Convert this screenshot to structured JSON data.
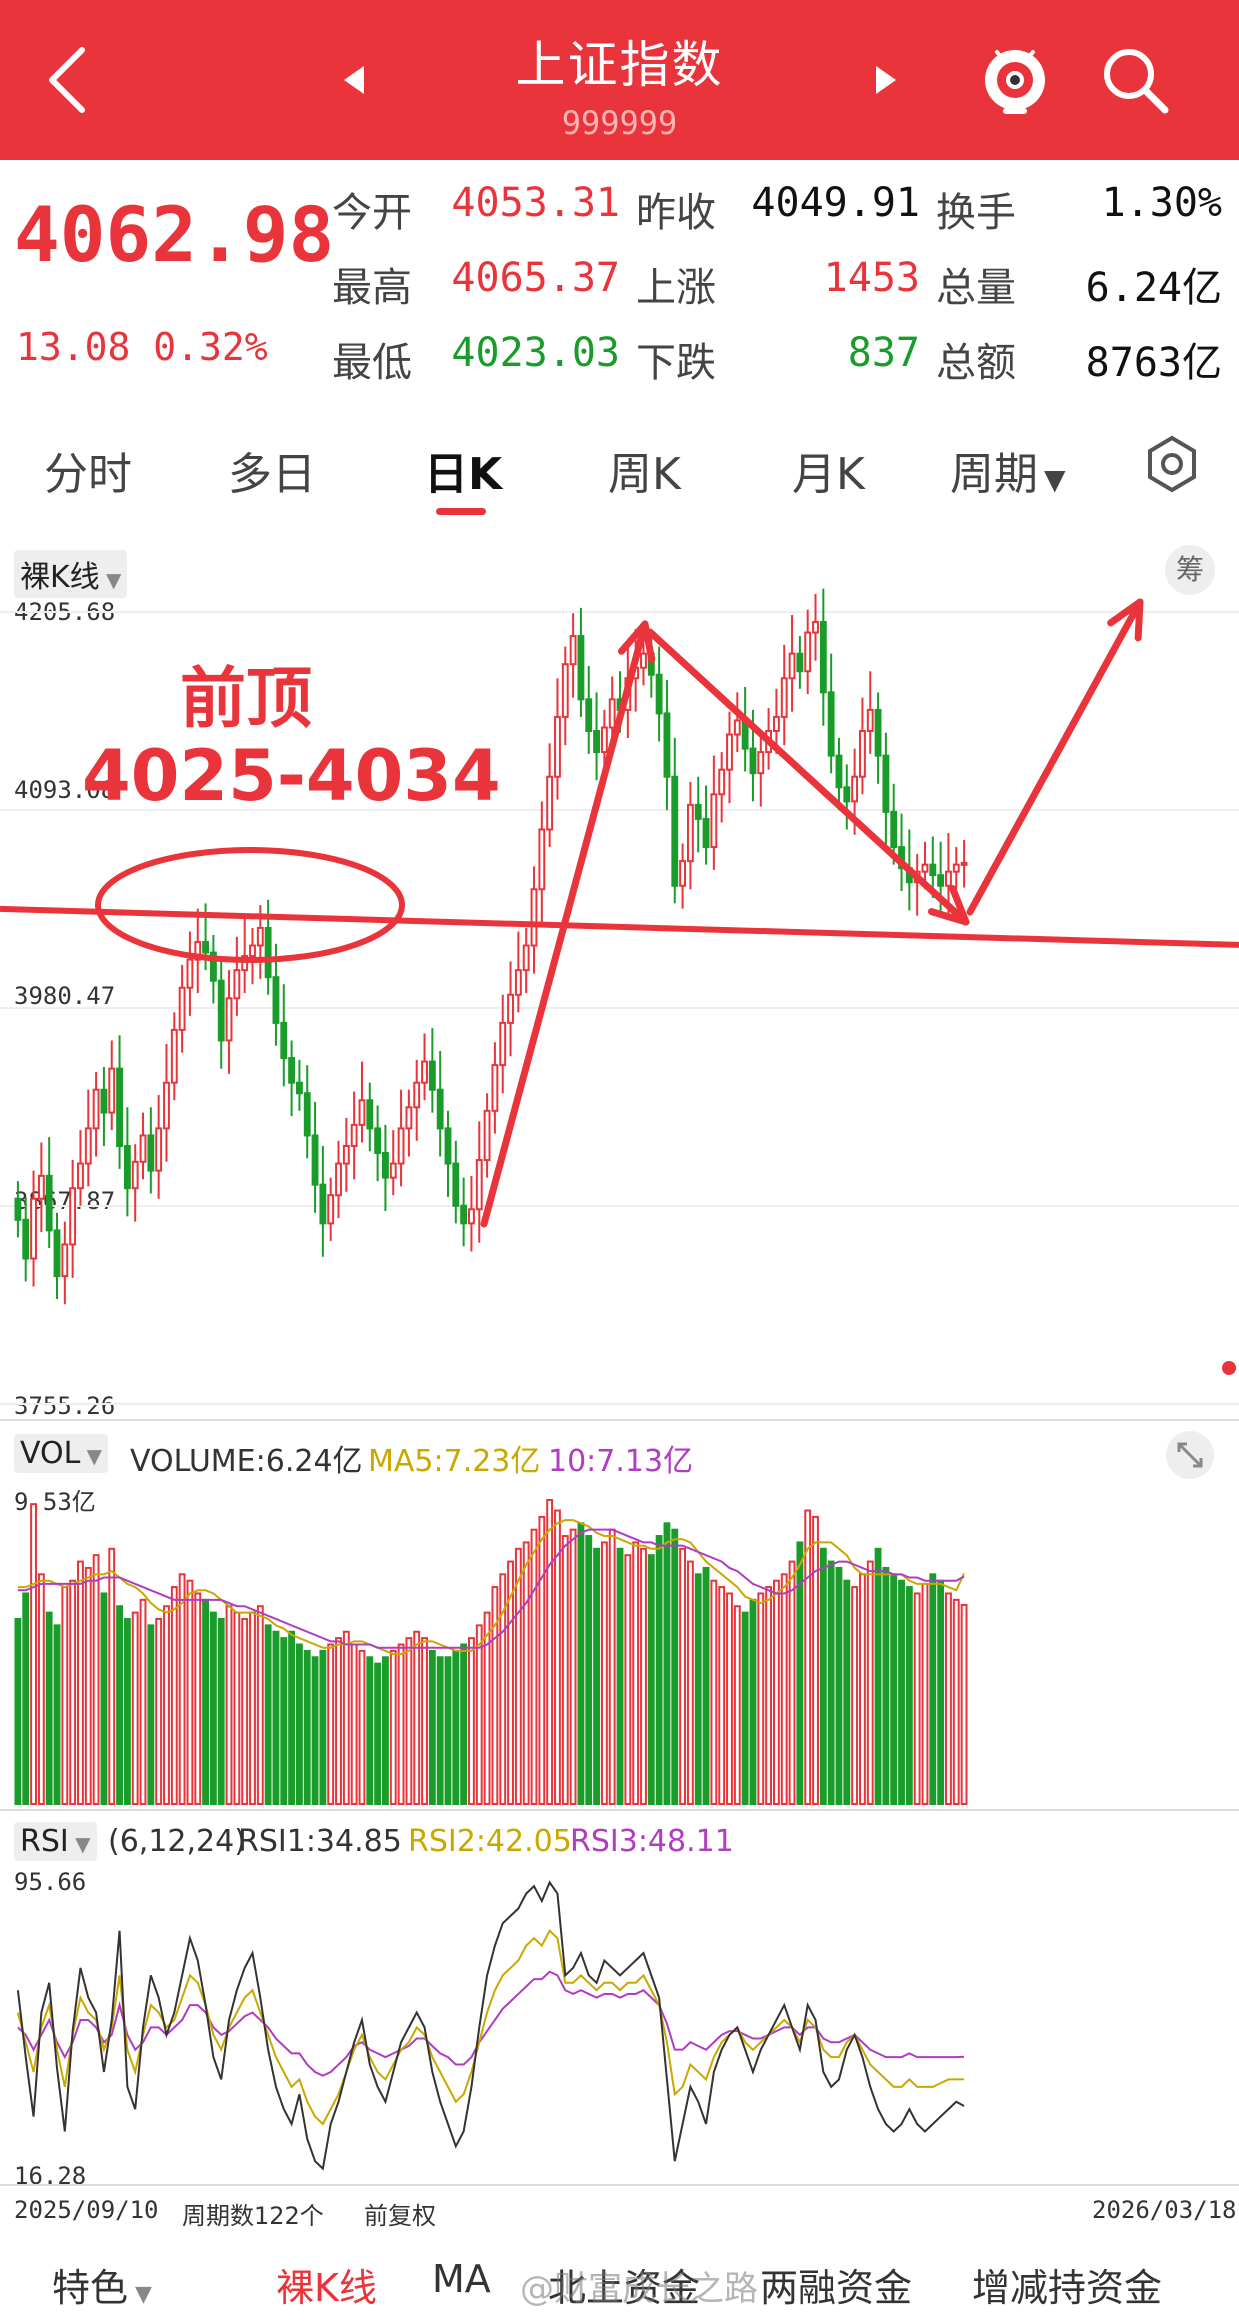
{
  "header": {
    "title": "上证指数",
    "code": "999999",
    "bg_color": "#e8343a"
  },
  "quote": {
    "price": "4062.98",
    "change": "13.08",
    "change_pct": "0.32%",
    "fields": [
      {
        "label": "今开",
        "value": "4053.31",
        "color": "red"
      },
      {
        "label": "昨收",
        "value": "4049.91",
        "color": "black"
      },
      {
        "label": "换手",
        "value": "1.30%",
        "color": "black"
      },
      {
        "label": "最高",
        "value": "4065.37",
        "color": "red"
      },
      {
        "label": "上涨",
        "value": "1453",
        "color": "red"
      },
      {
        "label": "总量",
        "value": "6.24亿",
        "color": "black"
      },
      {
        "label": "最低",
        "value": "4023.03",
        "color": "green"
      },
      {
        "label": "下跌",
        "value": "837",
        "color": "green"
      },
      {
        "label": "总额",
        "value": "8763亿",
        "color": "black"
      }
    ]
  },
  "tabs": [
    {
      "label": "分时"
    },
    {
      "label": "多日"
    },
    {
      "label": "日K",
      "active": true
    },
    {
      "label": "周K"
    },
    {
      "label": "月K"
    },
    {
      "label": "周期"
    }
  ],
  "kline": {
    "mode": "裸K线",
    "chip_btn": "筹",
    "y_labels": [
      "4205.68",
      "4093.08",
      "3980.47",
      "3867.87",
      "3755.26"
    ],
    "y_range": [
      3755.26,
      4205.68
    ],
    "annotation_title": "前顶",
    "annotation_range": "4025-4034",
    "resistance_level": 4030
  },
  "volume": {
    "tag": "VOL",
    "legend": {
      "volume": "VOLUME:6.24亿",
      "ma5": "MA5:7.23亿",
      "ma10": "10:7.13亿"
    },
    "max_label": "9.53亿"
  },
  "rsi": {
    "tag": "RSI",
    "legend": {
      "params": "(6,12,24)",
      "rsi1": "RSI1:34.85",
      "rsi2": "RSI2:42.05",
      "rsi3": "RSI3:48.11"
    },
    "top_label": "95.66",
    "bottom_label": "16.28"
  },
  "footer": {
    "start_date": "2025/09/10",
    "period_count": "周期数122个",
    "adjust": "前复权",
    "end_date": "2026/03/18"
  },
  "bottom_nav": [
    "特色",
    "裸K线",
    "MA",
    "北上资金",
    "两融资金",
    "增减持资金"
  ],
  "watermark": "@财富成长之路",
  "colors": {
    "up": "#e8343a",
    "down": "#1a9c2a",
    "ma5": "#c9a800",
    "ma10": "#b03cc0",
    "rsi1": "#333333"
  },
  "chart_data": {
    "type": "candlestick",
    "x_range": [
      "2025/09/10",
      "2026/03/18"
    ],
    "periods": 122,
    "price": [
      3860,
      3838,
      3872,
      3885,
      3854,
      3828,
      3846,
      3878,
      3892,
      3912,
      3934,
      3921,
      3946,
      3902,
      3878,
      3893,
      3908,
      3888,
      3912,
      3938,
      3968,
      3992,
      4008,
      4018,
      4012,
      3996,
      3962,
      3986,
      4002,
      4010,
      4016,
      4026,
      3998,
      3972,
      3952,
      3938,
      3932,
      3908,
      3880,
      3858,
      3874,
      3892,
      3902,
      3914,
      3928,
      3912,
      3898,
      3884,
      3892,
      3912,
      3924,
      3938,
      3950,
      3934,
      3912,
      3892,
      3868,
      3858,
      3866,
      3894,
      3922,
      3948,
      3972,
      3988,
      4002,
      4016,
      4048,
      4082,
      4112,
      4146,
      4176,
      4192,
      4156,
      4138,
      4126,
      4140,
      4156,
      4150,
      4168,
      4174,
      4182,
      4170,
      4148,
      4112,
      4050,
      4064,
      4096,
      4088,
      4072,
      4102,
      4116,
      4136,
      4144,
      4128,
      4114,
      4126,
      4138,
      4146,
      4168,
      4182,
      4172,
      4194,
      4200,
      4160,
      4124,
      4106,
      4098,
      4112,
      4138,
      4150,
      4124,
      4092,
      4072,
      4060,
      4052,
      4058,
      4062,
      4056,
      4050,
      4058,
      4062,
      4063
    ],
    "volume": [
      5.8,
      6.6,
      9.4,
      7.2,
      6.0,
      5.6,
      6.8,
      7.0,
      7.6,
      7.4,
      7.8,
      6.6,
      8.0,
      6.2,
      5.8,
      6.0,
      6.4,
      5.6,
      5.8,
      6.2,
      6.8,
      7.2,
      7.0,
      6.6,
      6.4,
      6.0,
      5.8,
      6.2,
      6.0,
      5.8,
      6.0,
      6.2,
      5.6,
      5.4,
      5.2,
      5.4,
      5.0,
      4.8,
      4.6,
      4.8,
      5.0,
      5.2,
      5.4,
      5.0,
      4.8,
      4.6,
      4.4,
      4.6,
      4.8,
      5.0,
      5.2,
      5.4,
      5.2,
      4.8,
      4.6,
      4.6,
      4.8,
      5.0,
      5.2,
      5.6,
      6.0,
      6.8,
      7.2,
      7.6,
      8.0,
      8.2,
      8.6,
      9.0,
      9.53,
      9.2,
      8.4,
      8.6,
      8.8,
      8.4,
      8.0,
      8.2,
      8.6,
      8.0,
      7.8,
      8.2,
      8.0,
      7.8,
      8.4,
      8.8,
      8.6,
      8.0,
      7.6,
      7.2,
      7.4,
      7.0,
      6.8,
      6.6,
      6.2,
      6.0,
      6.4,
      6.6,
      6.8,
      7.0,
      7.2,
      7.6,
      8.2,
      9.2,
      9.0,
      8.0,
      7.6,
      7.4,
      7.0,
      6.8,
      7.2,
      7.6,
      8.0,
      7.4,
      7.2,
      7.0,
      6.8,
      6.6,
      6.9,
      7.2,
      7.0,
      6.6,
      6.4,
      6.24
    ],
    "volume_ma5": [
      6.8,
      6.8,
      6.9,
      7.0,
      7.0,
      6.9,
      6.8,
      6.9,
      7.0,
      7.1,
      7.2,
      7.2,
      7.3,
      7.1,
      6.9,
      6.8,
      6.6,
      6.3,
      6.1,
      6.0,
      6.1,
      6.3,
      6.6,
      6.7,
      6.7,
      6.6,
      6.4,
      6.2,
      6.0,
      6.0,
      6.0,
      5.9,
      5.8,
      5.6,
      5.5,
      5.3,
      5.2,
      5.1,
      5.0,
      4.9,
      4.9,
      5.0,
      5.0,
      5.1,
      5.1,
      5.0,
      4.9,
      4.8,
      4.7,
      4.7,
      4.8,
      5.0,
      5.1,
      5.1,
      5.0,
      4.9,
      4.8,
      4.8,
      4.8,
      5.0,
      5.3,
      5.6,
      6.0,
      6.5,
      7.0,
      7.5,
      7.9,
      8.3,
      8.6,
      8.8,
      8.9,
      8.9,
      8.8,
      8.7,
      8.5,
      8.4,
      8.4,
      8.3,
      8.2,
      8.1,
      8.1,
      8.0,
      8.0,
      8.2,
      8.3,
      8.3,
      8.2,
      7.9,
      7.6,
      7.4,
      7.2,
      7.0,
      6.8,
      6.5,
      6.4,
      6.3,
      6.4,
      6.6,
      6.8,
      7.1,
      7.5,
      8.0,
      8.2,
      8.2,
      8.2,
      8.0,
      7.8,
      7.4,
      7.2,
      7.2,
      7.2,
      7.2,
      7.2,
      7.2,
      7.0,
      6.9,
      6.9,
      6.9,
      6.9,
      6.8,
      6.7,
      7.23
    ],
    "volume_ma10": [
      6.7,
      6.7,
      6.8,
      6.9,
      6.9,
      6.9,
      6.9,
      6.9,
      6.9,
      7.0,
      7.0,
      7.1,
      7.1,
      7.1,
      7.0,
      6.9,
      6.8,
      6.7,
      6.6,
      6.5,
      6.4,
      6.4,
      6.4,
      6.4,
      6.4,
      6.4,
      6.4,
      6.3,
      6.2,
      6.2,
      6.1,
      6.0,
      5.9,
      5.8,
      5.7,
      5.6,
      5.5,
      5.4,
      5.3,
      5.2,
      5.1,
      5.1,
      5.0,
      5.0,
      5.0,
      5.0,
      4.9,
      4.9,
      4.9,
      4.9,
      4.9,
      4.9,
      4.9,
      4.9,
      4.9,
      4.9,
      4.9,
      4.9,
      4.9,
      4.9,
      5.0,
      5.2,
      5.4,
      5.7,
      6.0,
      6.3,
      6.7,
      7.1,
      7.5,
      7.8,
      8.1,
      8.3,
      8.5,
      8.6,
      8.6,
      8.6,
      8.6,
      8.5,
      8.4,
      8.3,
      8.2,
      8.2,
      8.1,
      8.1,
      8.1,
      8.1,
      8.0,
      7.9,
      7.8,
      7.7,
      7.6,
      7.4,
      7.3,
      7.1,
      6.9,
      6.8,
      6.7,
      6.6,
      6.6,
      6.7,
      6.9,
      7.1,
      7.3,
      7.4,
      7.5,
      7.6,
      7.6,
      7.5,
      7.4,
      7.3,
      7.3,
      7.3,
      7.2,
      7.2,
      7.1,
      7.1,
      7.0,
      7.0,
      7.0,
      7.0,
      7.0,
      7.13
    ],
    "rsi1": [
      66,
      48,
      32,
      60,
      68,
      45,
      28,
      55,
      72,
      64,
      60,
      44,
      58,
      82,
      40,
      34,
      56,
      70,
      64,
      54,
      60,
      70,
      80,
      74,
      62,
      48,
      42,
      58,
      66,
      72,
      76,
      64,
      50,
      40,
      34,
      30,
      38,
      26,
      20,
      18,
      30,
      36,
      44,
      52,
      58,
      46,
      40,
      36,
      44,
      52,
      56,
      60,
      56,
      44,
      36,
      30,
      24,
      28,
      40,
      56,
      70,
      78,
      84,
      86,
      88,
      92,
      94,
      90,
      95,
      92,
      70,
      72,
      76,
      70,
      68,
      74,
      72,
      70,
      72,
      74,
      76,
      70,
      64,
      42,
      20,
      30,
      40,
      36,
      30,
      44,
      50,
      54,
      56,
      50,
      44,
      50,
      54,
      58,
      62,
      56,
      50,
      62,
      58,
      44,
      40,
      42,
      50,
      54,
      48,
      40,
      34,
      30,
      28,
      30,
      34,
      30,
      28,
      30,
      32,
      34,
      36,
      34.85
    ],
    "rsi2": [
      60,
      52,
      44,
      56,
      62,
      50,
      40,
      54,
      64,
      60,
      58,
      50,
      56,
      70,
      50,
      44,
      54,
      62,
      60,
      56,
      58,
      64,
      70,
      68,
      62,
      54,
      50,
      56,
      60,
      64,
      66,
      60,
      54,
      48,
      44,
      40,
      42,
      36,
      32,
      30,
      34,
      38,
      44,
      50,
      54,
      48,
      44,
      42,
      46,
      50,
      52,
      56,
      54,
      48,
      44,
      40,
      36,
      38,
      44,
      52,
      60,
      66,
      70,
      72,
      74,
      78,
      80,
      78,
      82,
      80,
      68,
      68,
      70,
      68,
      66,
      68,
      68,
      66,
      68,
      68,
      70,
      66,
      62,
      52,
      38,
      40,
      46,
      44,
      42,
      48,
      52,
      54,
      56,
      52,
      50,
      52,
      54,
      56,
      58,
      56,
      52,
      58,
      56,
      50,
      48,
      48,
      52,
      54,
      50,
      46,
      44,
      42,
      40,
      40,
      42,
      40,
      40,
      40,
      41,
      42,
      42,
      42.05
    ],
    "rsi3": [
      56,
      54,
      50,
      54,
      58,
      52,
      48,
      52,
      58,
      58,
      56,
      52,
      54,
      62,
      54,
      50,
      52,
      56,
      56,
      54,
      56,
      58,
      62,
      62,
      60,
      56,
      54,
      55,
      57,
      59,
      60,
      58,
      56,
      53,
      51,
      49,
      49,
      46,
      44,
      43,
      44,
      46,
      48,
      51,
      52,
      50,
      49,
      48,
      49,
      50,
      51,
      53,
      53,
      51,
      49,
      48,
      46,
      46,
      48,
      52,
      55,
      58,
      61,
      63,
      65,
      67,
      69,
      69,
      71,
      70,
      66,
      65,
      66,
      65,
      64,
      65,
      65,
      64,
      65,
      65,
      66,
      64,
      62,
      57,
      50,
      50,
      52,
      51,
      50,
      52,
      54,
      55,
      55,
      54,
      53,
      53,
      54,
      55,
      56,
      56,
      54,
      56,
      56,
      53,
      52,
      52,
      53,
      54,
      52,
      50,
      49,
      48,
      48,
      48,
      49,
      48,
      48,
      48,
      48,
      48,
      48,
      48.11
    ]
  }
}
